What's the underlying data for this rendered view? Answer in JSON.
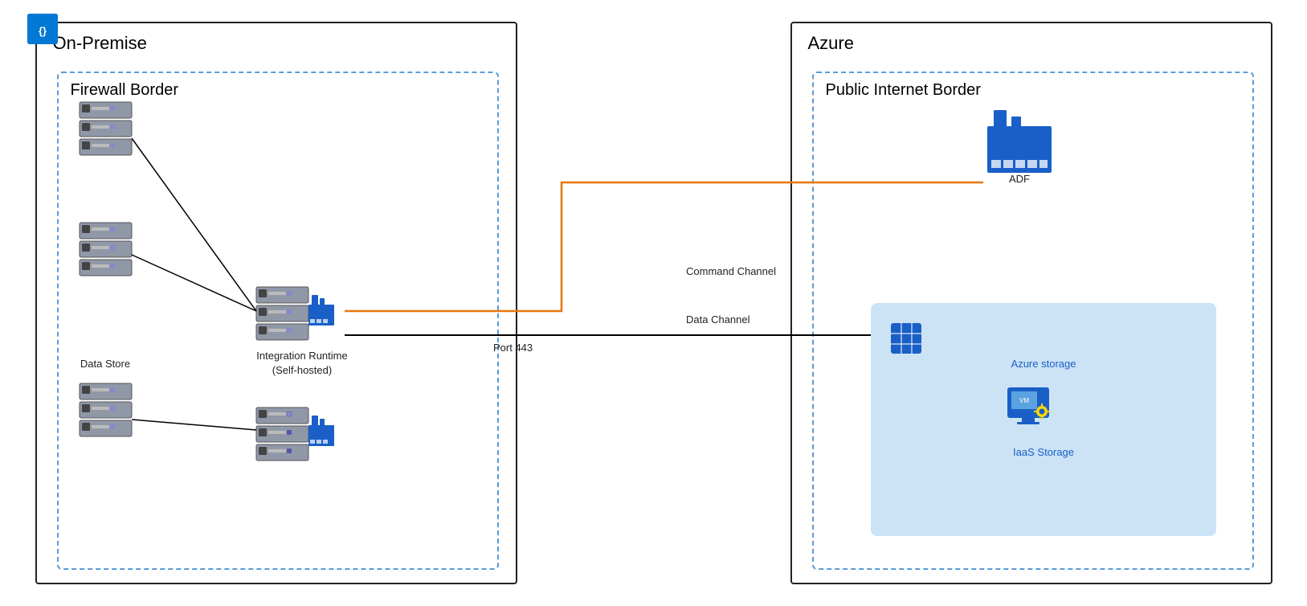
{
  "diagram": {
    "title_on_premise": "On-Premise",
    "title_azure": "Azure",
    "title_firewall": "Firewall Border",
    "title_public_internet": "Public Internet Border",
    "labels": {
      "data_store": "Data Store",
      "integration_runtime": "Integration Runtime\n(Self-hosted)",
      "adf": "ADF",
      "azure_storage": "Azure storage",
      "iaas_storage": "IaaS Storage",
      "command_channel": "Command Channel",
      "data_channel": "Data Channel",
      "port_443": "Port 443"
    },
    "colors": {
      "black_border": "#222222",
      "dashed_border": "#5b9bd5",
      "azure_blue": "#1a5fc8",
      "orange_line": "#e8760a",
      "black_line": "#000000",
      "light_blue_bg": "#cce3f5"
    }
  }
}
